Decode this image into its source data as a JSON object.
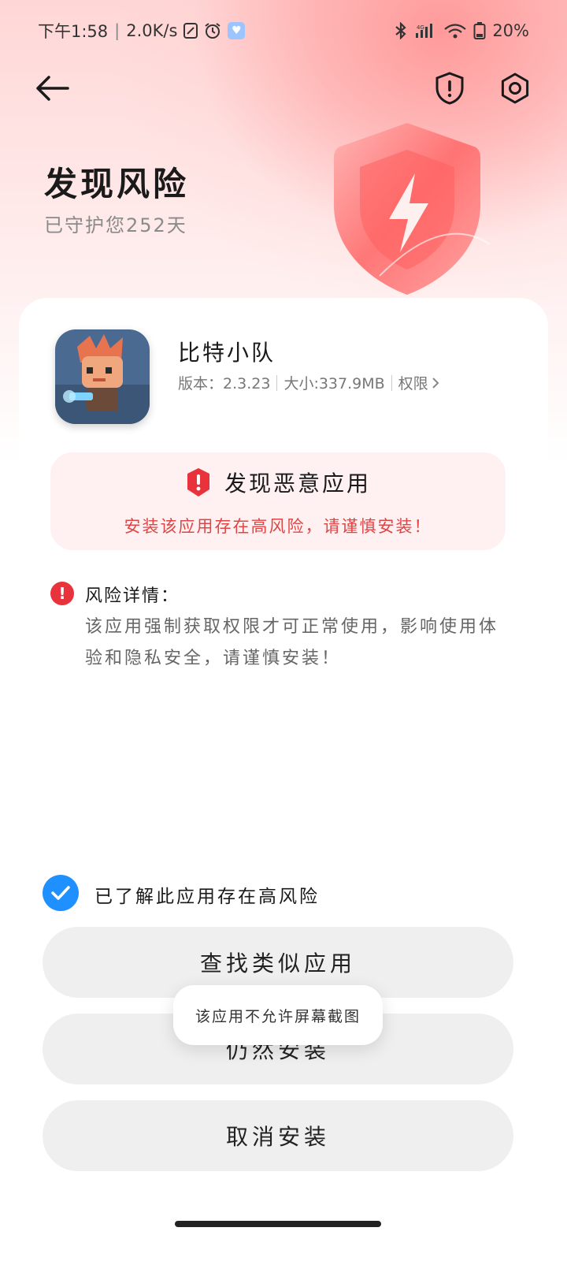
{
  "status_bar": {
    "time": "下午1:58",
    "network_speed": "2.0K/s",
    "battery": "20%",
    "icons": [
      "app-notification-icon",
      "alarm-icon",
      "message-icon",
      "bluetooth-icon",
      "signal-icon",
      "wifi-icon",
      "battery-icon"
    ]
  },
  "header": {
    "back_icon": "arrow-left-icon",
    "shield_icon": "shield-alert-icon",
    "settings_icon": "gear-icon",
    "title": "发现风险",
    "subtitle": "已守护您252天"
  },
  "app": {
    "name": "比特小队",
    "version_label": "版本：2.3.23",
    "size_label": "大小:337.9MB",
    "permission_label": "权限"
  },
  "risk": {
    "title": "发现恶意应用",
    "warning": "安装该应用存在高风险，请谨慎安装！"
  },
  "details": {
    "label": "风险详情：",
    "body": "该应用强制获取权限才可正常使用，影响使用体验和隐私安全，请谨慎安装！"
  },
  "acknowledge": {
    "label": "已了解此应用存在高风险",
    "checked": true
  },
  "buttons": {
    "find_similar": "查找类似应用",
    "install_anyway": "仍然安装",
    "cancel_install": "取消安装"
  },
  "toast": {
    "text": "该应用不允许屏幕截图"
  },
  "colors": {
    "accent_blue": "#1e90ff",
    "danger_red": "#e8333c",
    "warning_text": "#e04545"
  }
}
